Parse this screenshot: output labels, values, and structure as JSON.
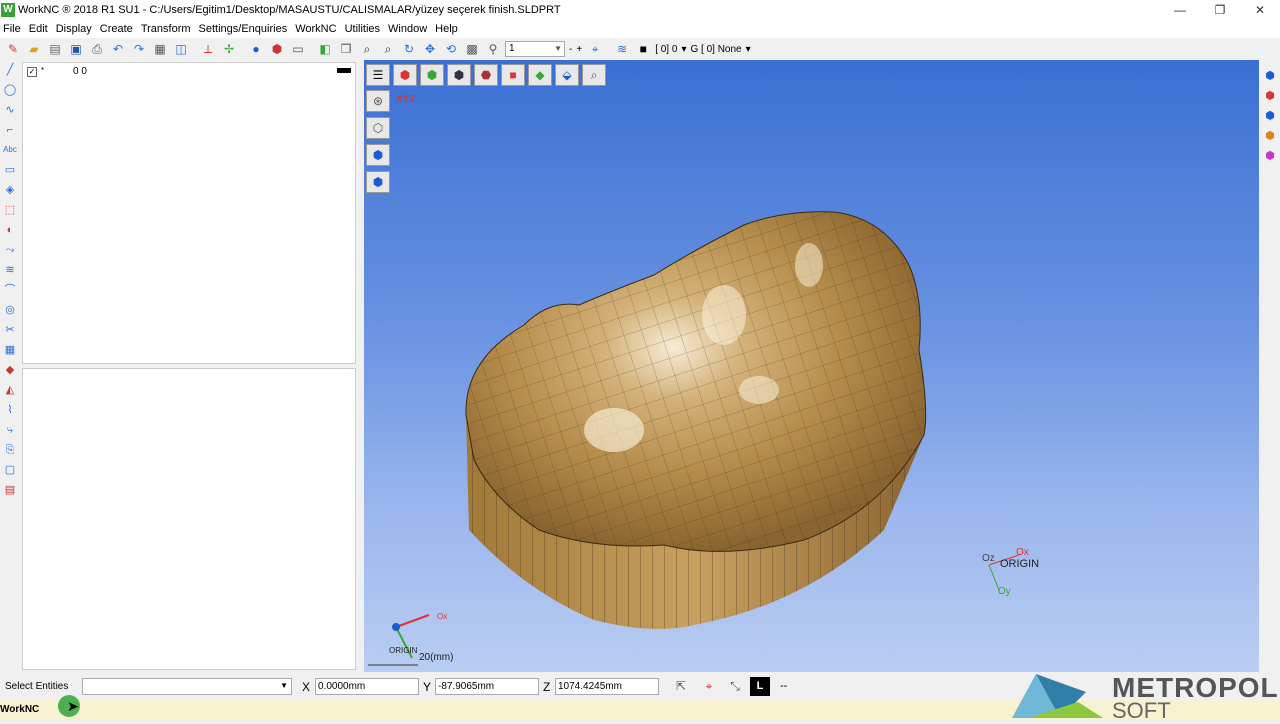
{
  "window": {
    "app_logo": "W",
    "title": "WorkNC ® 2018 R1 SU1 - C:/Users/Egitim1/Desktop/MASAUSTU/CALISMALAR/yüzey seçerek finish.SLDPRT",
    "minimize": "—",
    "maximize": "❐",
    "close": "✕"
  },
  "menu": [
    "File",
    "Edit",
    "Display",
    "Create",
    "Transform",
    "Settings/Enquiries",
    "WorkNC",
    "Utilities",
    "Window",
    "Help"
  ],
  "toolbar": {
    "icons": [
      "new-icon",
      "open-icon",
      "import-icon",
      "save-icon",
      "print-icon",
      "undo-icon",
      "redo-icon",
      "grid-icon",
      "view-icon",
      "axes-icon",
      "csys-icon",
      "sphere-icon",
      "shade-icon",
      "render-icon",
      "layer-icon",
      "copy-icon",
      "zoom-icon",
      "zoom-window-icon",
      "rotate-icon",
      "pan-icon",
      "orbit-icon",
      "fit-icon",
      "filter-icon"
    ],
    "zoom_value": "1",
    "minus": "-",
    "plus": "+",
    "layer_text": "[ 0] 0",
    "group_text": "G [ 0] None"
  },
  "layers_panel": {
    "check": "✓",
    "star": "*",
    "layer_label": "0 0"
  },
  "statusbar": {
    "select_label": "Select Entities",
    "x_label": "X",
    "x_value": "0.0000mm",
    "y_label": "Y",
    "y_value": "-87.9065mm",
    "z_label": "Z",
    "z_value": "1074.4245mm",
    "l_button": "L",
    "dash": "--"
  },
  "viewport": {
    "origin_label": "ORIGIN",
    "ox": "Ox",
    "oy": "Oy",
    "oz": "Oz",
    "corner_origin": "ORIGIN",
    "corner_ox": "Ox",
    "scale_label": "20(mm)",
    "model_color": "#c9a468"
  },
  "brand": {
    "name": "METROPOL",
    "sub": "SOFT"
  },
  "bottom": {
    "app_name": "WorkNC"
  }
}
